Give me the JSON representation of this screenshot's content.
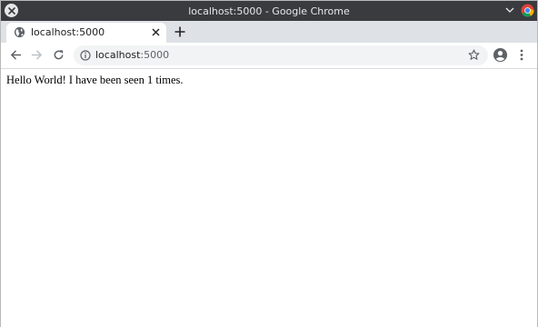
{
  "window": {
    "title": "localhost:5000 - Google Chrome"
  },
  "tab": {
    "label": "localhost:5000",
    "favicon": "globe-icon"
  },
  "toolbar": {
    "url_host": "localhost",
    "url_port": ":5000"
  },
  "page": {
    "body_text": "Hello World! I have been seen 1 times."
  },
  "colors": {
    "titlebar": "#3a3b3f",
    "tabstrip": "#dee1e6",
    "omnibox": "#f1f3f4"
  }
}
